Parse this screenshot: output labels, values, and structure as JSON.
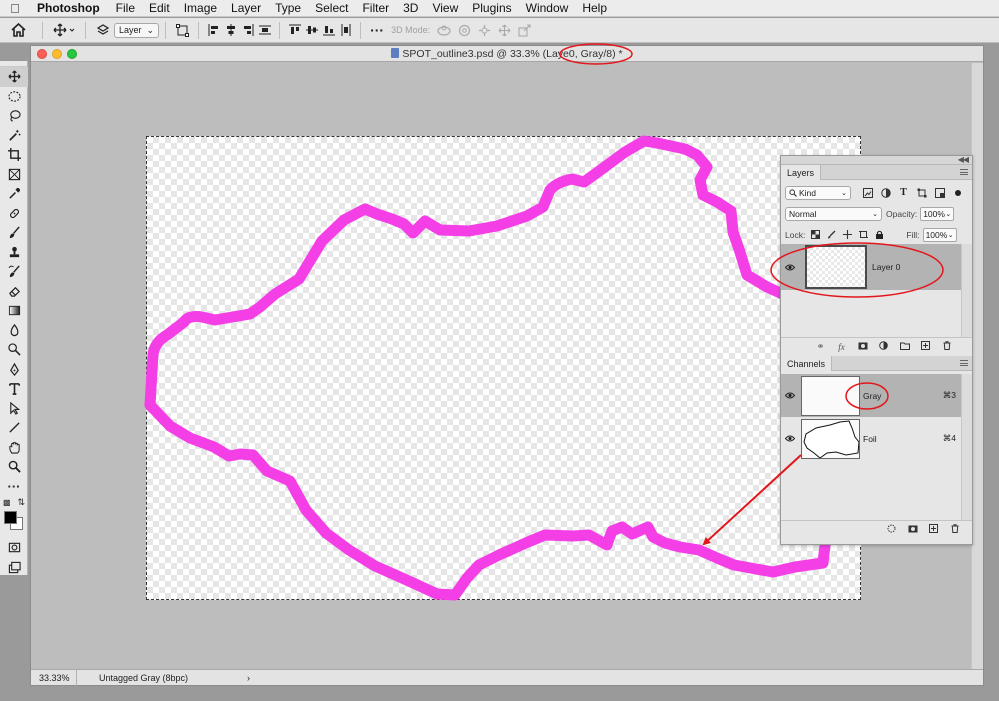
{
  "menubar": {
    "app_name": "Photoshop",
    "items": [
      "File",
      "Edit",
      "Image",
      "Layer",
      "Type",
      "Select",
      "Filter",
      "3D",
      "View",
      "Plugins",
      "Window",
      "Help"
    ]
  },
  "options_bar": {
    "auto_select_target": "Layer",
    "mode_3d_label": "3D Mode:"
  },
  "document": {
    "title_prefix": "SPOT_outline3.psd @ 33.3% (Laye",
    "title_suffix": "0, Gray/8) *",
    "zoom": "33.33%",
    "doc_info": "Untagged Gray (8bpc)",
    "status_arrow": "›"
  },
  "layers_panel": {
    "tab": "Layers",
    "filter_kind": "Kind",
    "blend_mode": "Normal",
    "opacity_label": "Opacity:",
    "opacity": "100%",
    "lock_label": "Lock:",
    "fill_label": "Fill:",
    "fill": "100%",
    "layers": [
      {
        "name": "Layer 0"
      }
    ]
  },
  "channels_panel": {
    "tab": "Channels",
    "channels": [
      {
        "name": "Gray",
        "shortcut": "⌘3"
      },
      {
        "name": "Foil",
        "shortcut": "⌘4"
      }
    ]
  },
  "colors": {
    "outline_stroke": "#f43fe6",
    "annotation_red": "#e3161b"
  }
}
